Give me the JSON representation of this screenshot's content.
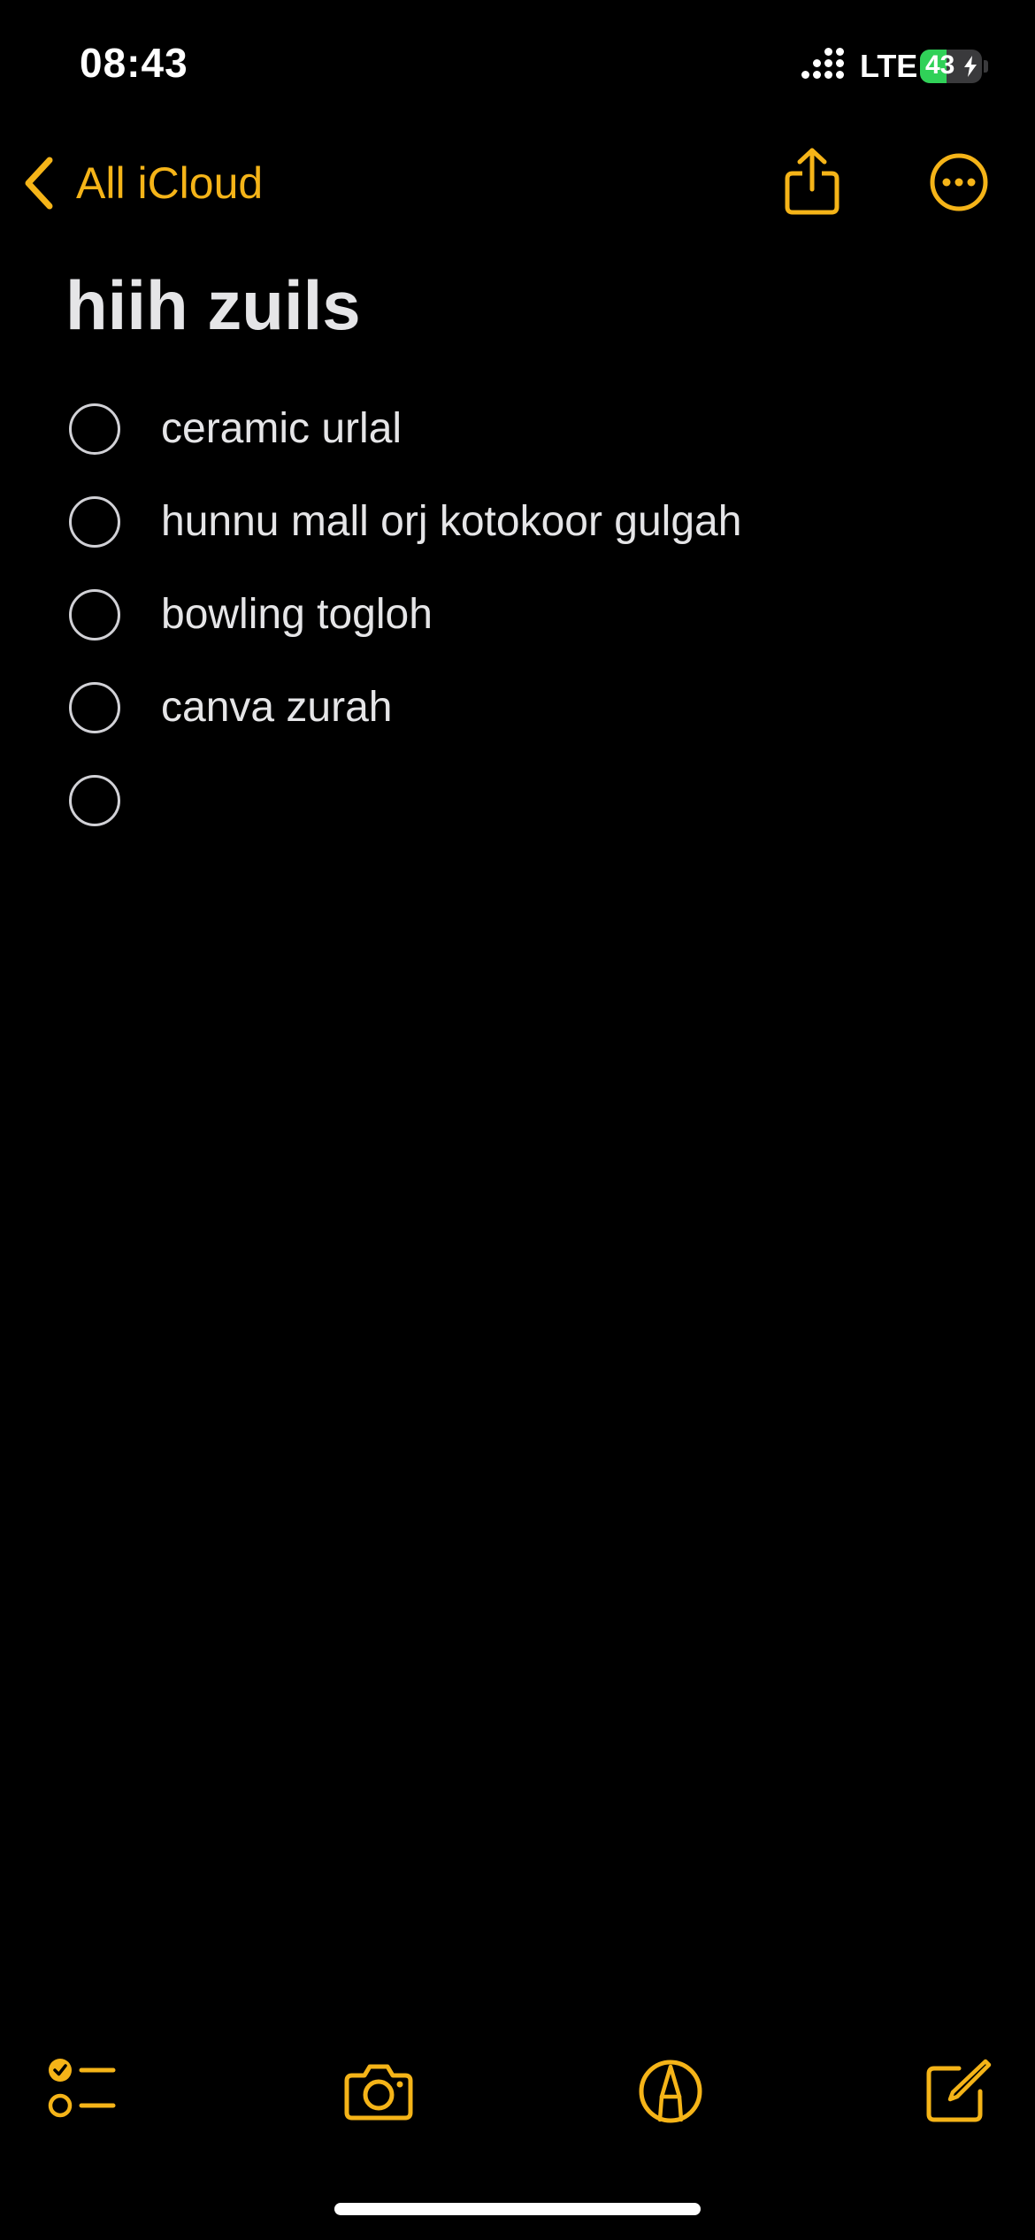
{
  "status_bar": {
    "time": "08:43",
    "network": "LTE",
    "battery_percent": "43",
    "battery_level": 0.43,
    "charging": true,
    "battery_color": "#30d158"
  },
  "nav": {
    "back_label": "All iCloud",
    "back_icon": "chevron-left-icon",
    "share_icon": "share-icon",
    "more_icon": "more-ellipsis-icon",
    "accent_color": "#f5b418"
  },
  "note": {
    "title": "hiih zuils",
    "checklist": [
      {
        "label": "ceramic urlal",
        "checked": false
      },
      {
        "label": "hunnu mall orj kotokoor gulgah",
        "checked": false
      },
      {
        "label": "bowling togloh",
        "checked": false
      },
      {
        "label": "canva zurah",
        "checked": false
      },
      {
        "label": "",
        "checked": false
      }
    ]
  },
  "toolbar": {
    "items": [
      "checklist-icon",
      "camera-icon",
      "markup-icon",
      "compose-icon"
    ]
  }
}
